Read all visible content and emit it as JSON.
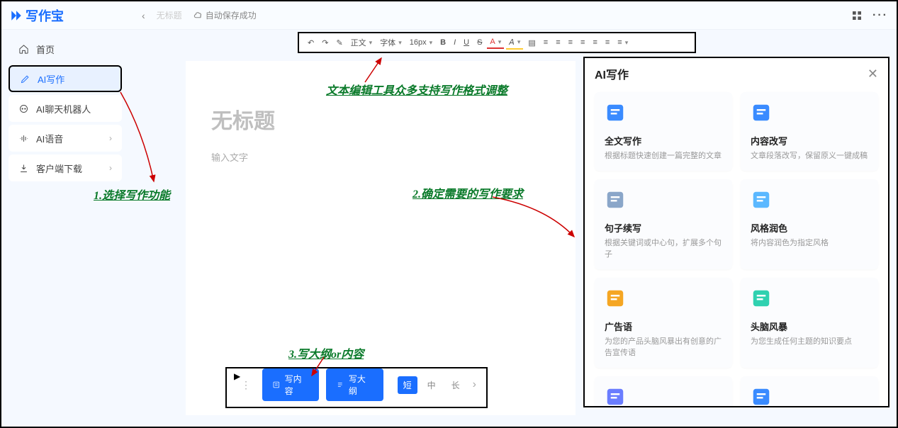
{
  "app": {
    "name": "写作宝"
  },
  "topbar": {
    "back": "‹",
    "untitled": "无标题",
    "autosave": "自动保存成功"
  },
  "sidebar": {
    "items": [
      {
        "label": "首页",
        "has_chevron": false
      },
      {
        "label": "AI写作",
        "has_chevron": false,
        "active": true
      },
      {
        "label": "AI聊天机器人",
        "has_chevron": false
      },
      {
        "label": "AI语音",
        "has_chevron": true
      },
      {
        "label": "客户端下载",
        "has_chevron": true
      }
    ]
  },
  "toolbar": {
    "items": [
      "↶",
      "↷",
      "✎",
      "正文",
      "字体",
      "16px",
      "B",
      "I",
      "U",
      "S",
      "A",
      "𝘈",
      "▮",
      "≡",
      "≡",
      "≡",
      "≡",
      "≡",
      "≡",
      "≡"
    ],
    "dropdown_at": [
      3,
      4,
      5,
      10,
      11,
      19
    ]
  },
  "editor": {
    "title": "无标题",
    "body_placeholder": "输入文字"
  },
  "bottombar": {
    "write_content": "写内容",
    "write_outline": "写大纲",
    "length_short": "短",
    "length_mid": "中",
    "length_long": "长"
  },
  "panel": {
    "title": "AI写作",
    "cards": [
      {
        "title": "全文写作",
        "desc": "根据标题快速创建一篇完整的文章",
        "icon_color": "#3a8bff"
      },
      {
        "title": "内容改写",
        "desc": "文章段落改写，保留原义一键成稿",
        "icon_color": "#3a8bff"
      },
      {
        "title": "句子续写",
        "desc": "根据关键词或中心句，扩展多个句子",
        "icon_color": "#8aa6c9"
      },
      {
        "title": "风格润色",
        "desc": "将内容润色为指定风格",
        "icon_color": "#5bb8ff"
      },
      {
        "title": "广告语",
        "desc": "为您的产品头脑风暴出有创意的广告宣传语",
        "icon_color": "#f5a623"
      },
      {
        "title": "头脑风暴",
        "desc": "为您生成任何主题的知识要点",
        "icon_color": "#2fd1b0"
      },
      {
        "title": "",
        "desc": "",
        "icon_color": "#6a7dff"
      },
      {
        "title": "",
        "desc": "",
        "icon_color": "#3a8bff"
      }
    ]
  },
  "annotations": {
    "a1": "1.选择写作功能",
    "a2": "文本编辑工具众多支持写作格式调整",
    "a3": "2.确定需要的写作要求",
    "a4": "3.写大纲or内容"
  }
}
